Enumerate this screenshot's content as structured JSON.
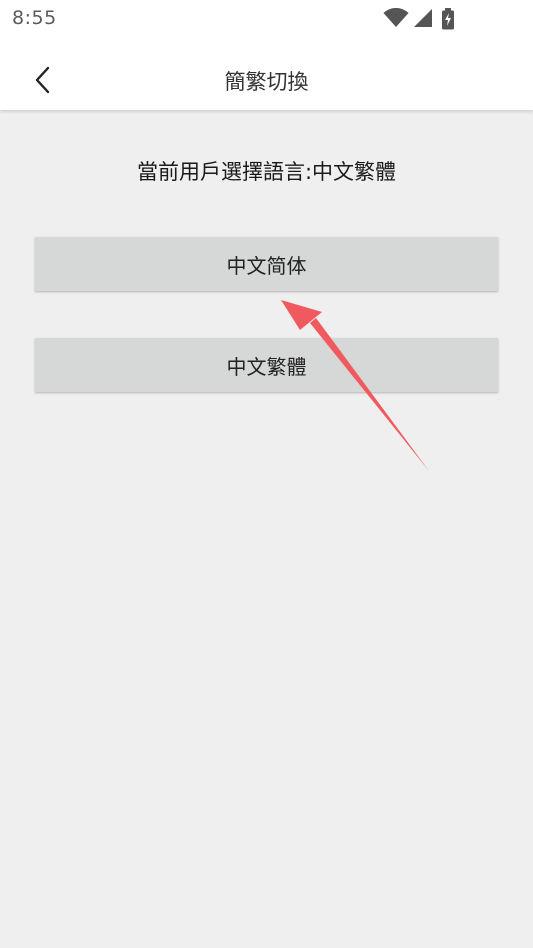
{
  "status_bar": {
    "time": "8:55",
    "icons": [
      "wifi-icon",
      "cell-signal-icon",
      "battery-charging-icon"
    ]
  },
  "app_bar": {
    "back_icon": "chevron-left-icon",
    "title": "簡繁切換"
  },
  "content": {
    "current_language_text": "當前用戶選擇語言:中文繁體",
    "buttons": [
      {
        "label": "中文简体"
      },
      {
        "label": "中文繁體"
      }
    ]
  },
  "colors": {
    "background": "#efefef",
    "button_bg": "#d6d7d7",
    "arrow": "#f05a5f"
  }
}
